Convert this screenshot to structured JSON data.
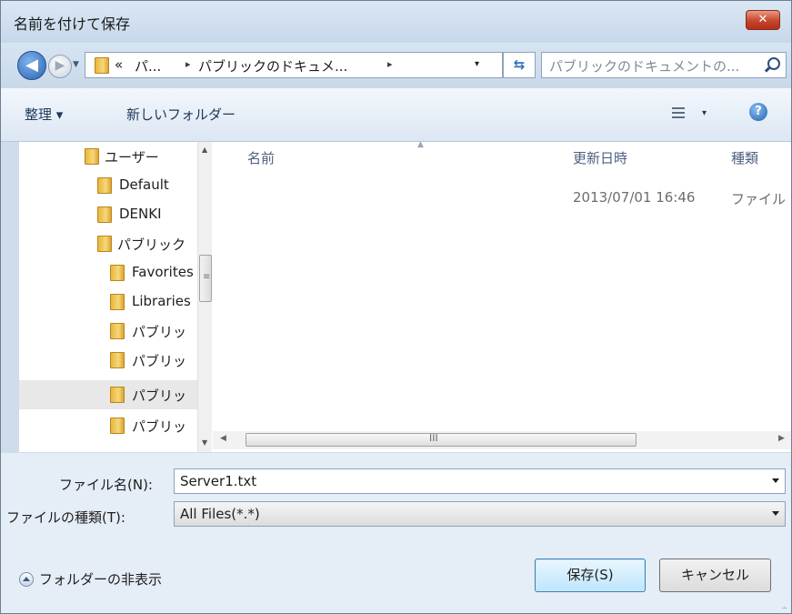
{
  "window": {
    "title": "名前を付けて保存",
    "close_symbol": "✕"
  },
  "address": {
    "crumb_overflow": "«",
    "crumb1": "パ...",
    "crumb2": "パブリックのドキュメ...",
    "separator": "▸",
    "dropdown": "▾"
  },
  "search": {
    "placeholder": "パブリックのドキュメントの..."
  },
  "toolbar": {
    "organize": "整理 ▾",
    "new_folder": "新しいフォルダー",
    "view_dropdown": "▾",
    "help": "?"
  },
  "nav": {
    "items": [
      {
        "label": "ユーザー",
        "icon": "folder-icon"
      },
      {
        "label": "Default",
        "icon": "folder-icon"
      },
      {
        "label": "DENKI",
        "icon": "user-folder-icon"
      },
      {
        "label": "パブリック",
        "icon": "folder-icon"
      },
      {
        "label": "Favorites",
        "icon": "folder-icon"
      },
      {
        "label": "Libraries",
        "icon": "folder-icon"
      },
      {
        "label": "パブリッ",
        "icon": "folder-icon"
      },
      {
        "label": "パブリッ",
        "icon": "folder-icon"
      },
      {
        "label": "パブリッ",
        "icon": "folder-icon",
        "selected": true
      },
      {
        "label": "パブリッ",
        "icon": "folder-icon"
      }
    ]
  },
  "files": {
    "columns": [
      "名前",
      "更新日時",
      "種類"
    ],
    "rows": [
      {
        "name": "",
        "modified": "2013/07/01 16:46",
        "type": "ファイル"
      }
    ],
    "hscroll_grip": "III"
  },
  "form": {
    "filename_label": "ファイル名(N):",
    "filename_value": "Server1.txt",
    "filetype_label": "ファイルの種類(T):",
    "filetype_value": "All Files(*.*)"
  },
  "footer": {
    "hide_folders": "フォルダーの非表示",
    "save_button": "保存(S)",
    "cancel_button": "キャンセル"
  },
  "colors": {
    "accent": "#3c7fb1",
    "chrome": "#cfdcea",
    "close": "#c6452c"
  }
}
